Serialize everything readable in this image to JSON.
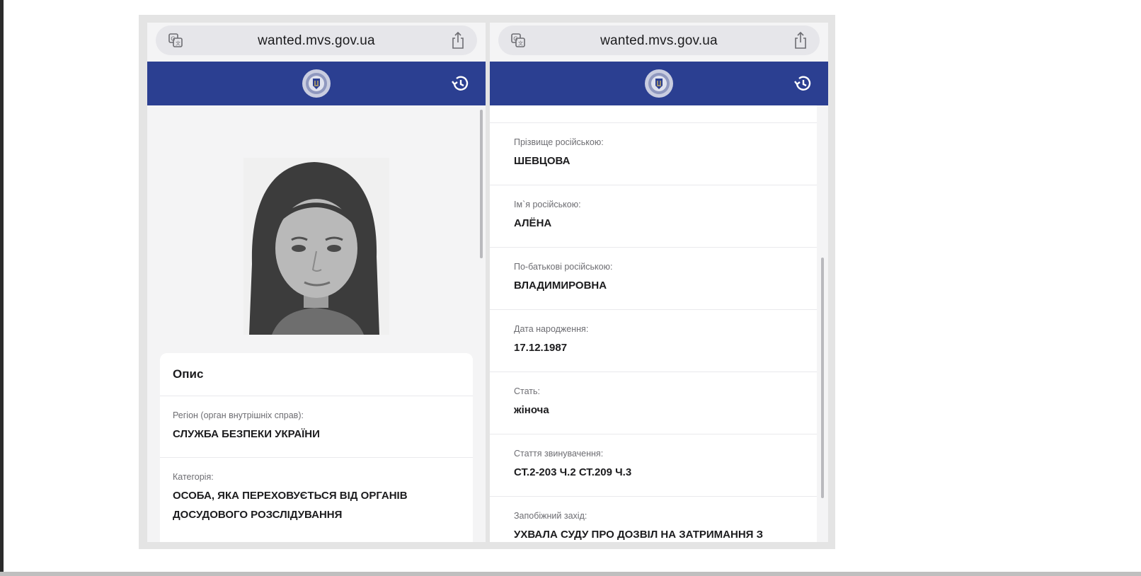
{
  "left_phone": {
    "url": "wanted.mvs.gov.ua",
    "description_card": {
      "title": "Опис",
      "region_label": "Регіон (орган внутрішніх справ):",
      "region_value": "СЛУЖБА БЕЗПЕКИ УКРАЇНИ",
      "category_label": "Категорія:",
      "category_value_line1": "ОСОБА, ЯКА ПЕРЕХОВУЄТЬСЯ ВІД ОРГАНІВ",
      "category_value_line2": "ДОСУДОВОГО РОЗСЛІДУВАННЯ"
    }
  },
  "right_phone": {
    "url": "wanted.mvs.gov.ua",
    "fields": [
      {
        "label": "Прізвище російською:",
        "value": "ШЕВЦОВА"
      },
      {
        "label": "Ім`я російською:",
        "value": "АЛЁНА"
      },
      {
        "label": "По-батькові російською:",
        "value": "ВЛАДИМИРОВНА"
      },
      {
        "label": "Дата народження:",
        "value": "17.12.1987"
      },
      {
        "label": "Стать:",
        "value": "жіноча"
      },
      {
        "label": "Стаття звинувачення:",
        "value": "СТ.2-203 Ч.2 СТ.209 Ч.3"
      },
      {
        "label": "Запобіжний захід:",
        "value": "УХВАЛА СУДУ ПРО ДОЗВІЛ НА ЗАТРИМАННЯ З"
      }
    ]
  },
  "colors": {
    "nav_bar": "#2b3f91",
    "page_bg": "#f4f4f5",
    "card_bg": "#ffffff"
  },
  "icons": {
    "addr_left": "translate-icon",
    "addr_right": "share-icon",
    "nav_center": "police-emblem-icon",
    "nav_right": "history-icon"
  }
}
